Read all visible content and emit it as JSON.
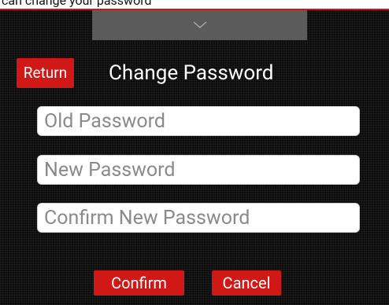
{
  "caption": "can change your password",
  "pull_tab_icon": "chevron-down-icon",
  "header": {
    "return_label": "Return",
    "title": "Change Password"
  },
  "form": {
    "old_password_placeholder": "Old Password",
    "new_password_placeholder": "New Password",
    "confirm_password_placeholder": "Confirm New Password"
  },
  "actions": {
    "confirm_label": "Confirm",
    "cancel_label": "Cancel"
  },
  "colors": {
    "accent": "#d01816",
    "background": "#0b0b0b",
    "pull_tab": "#5b5b5b"
  }
}
